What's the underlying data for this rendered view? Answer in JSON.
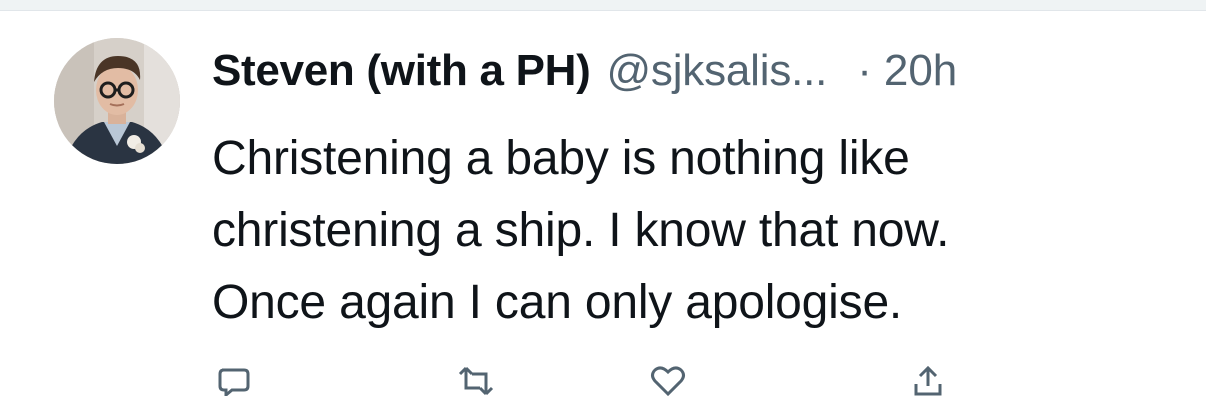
{
  "tweet": {
    "display_name": "Steven (with a PH)",
    "handle": "@sjksalis...",
    "separator": "·",
    "time": "20h",
    "lines": [
      "Christening a baby is nothing like",
      "christening a ship. I know that now.",
      "Once again I can only apologise."
    ]
  },
  "actions": [
    {
      "icon": "reply-icon"
    },
    {
      "icon": "retweet-icon"
    },
    {
      "icon": "like-icon"
    },
    {
      "icon": "share-icon"
    }
  ],
  "colors": {
    "text_primary": "#0f1419",
    "text_secondary": "#536471",
    "divider": "#eff3f4"
  }
}
